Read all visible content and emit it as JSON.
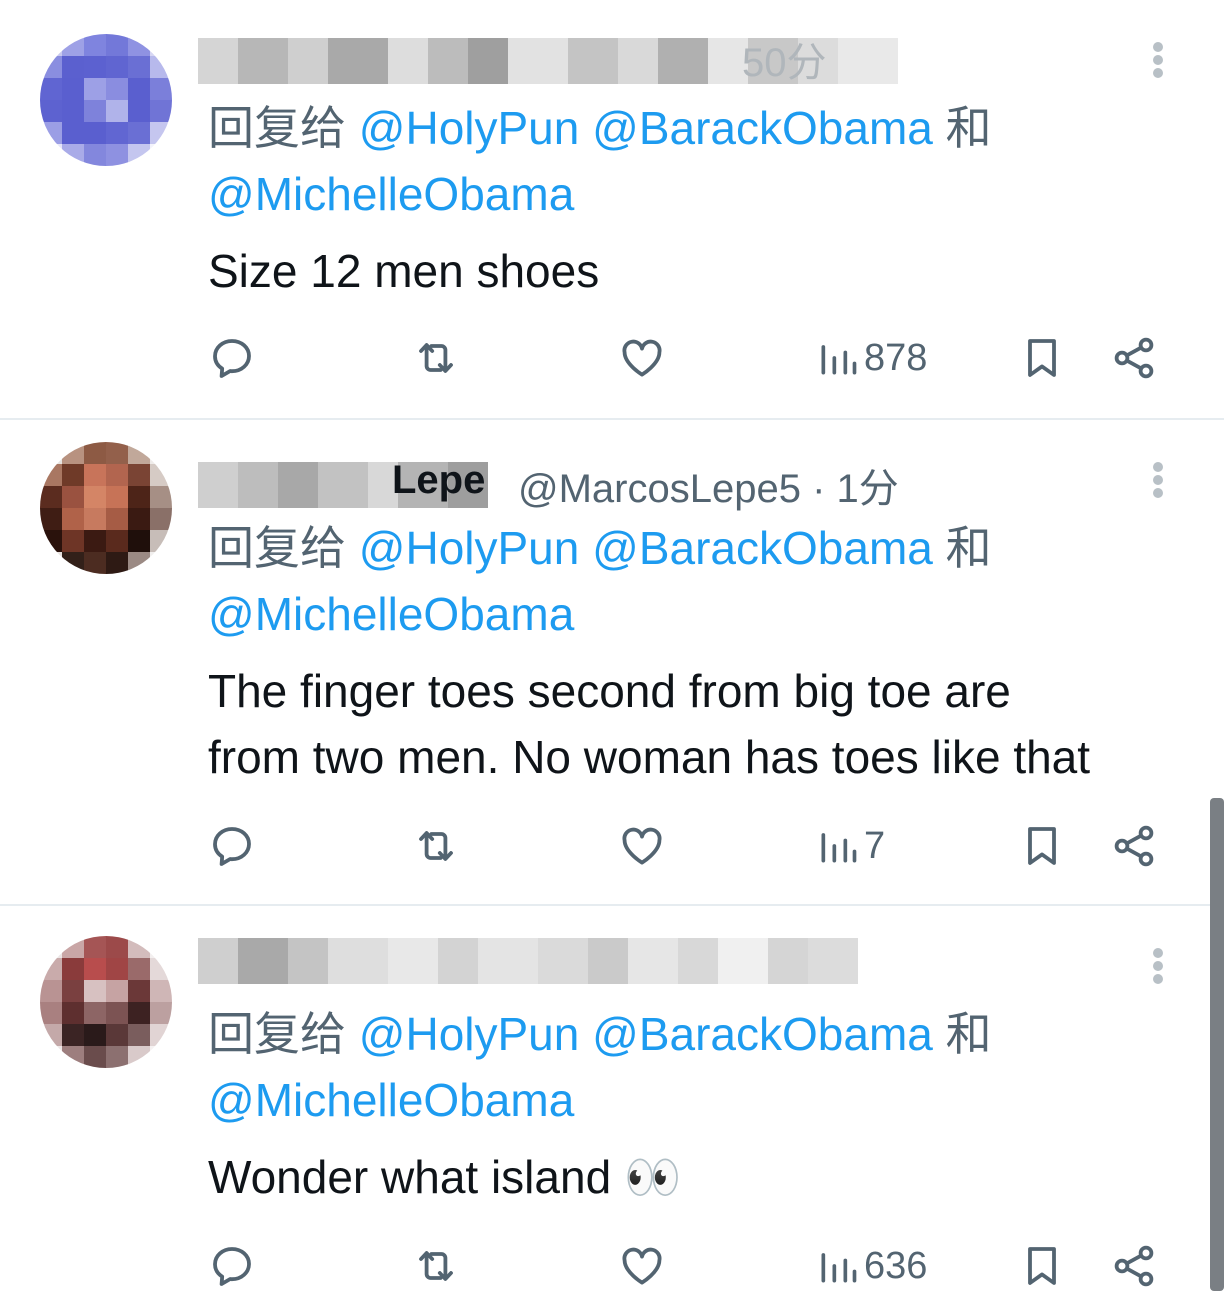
{
  "tweets": [
    {
      "author_meta": "50分",
      "reply_prefix": "回复给",
      "mention1": "@HolyPun",
      "mention2": "@BarackObama",
      "and_word": "和",
      "mention3": "@MichelleObama",
      "text": "Size 12 men shoes",
      "views": "878"
    },
    {
      "author_meta": "@MarcosLepe5 · 1分",
      "name_tail": "Lepe",
      "reply_prefix": "回复给",
      "mention1": "@HolyPun",
      "mention2": "@BarackObama",
      "and_word": "和",
      "mention3": "@MichelleObama",
      "text_line1": "The finger toes second from big toe are",
      "text_line2": "from two men. No woman has toes like that",
      "views": "7"
    },
    {
      "reply_prefix": "回复给",
      "mention1": "@HolyPun",
      "mention2": "@BarackObama",
      "and_word": "和",
      "mention3": "@MichelleObama",
      "text": "Wonder what island",
      "emoji": "👀",
      "views": "636"
    }
  ],
  "icons": [
    "reply-icon",
    "retweet-icon",
    "like-icon",
    "views-icon",
    "bookmark-icon",
    "share-icon",
    "more-icon"
  ],
  "colors": {
    "mention": "#1d9bf0",
    "secondary": "#536471",
    "text": "#0f1419",
    "divider": "#e6ecf0"
  }
}
